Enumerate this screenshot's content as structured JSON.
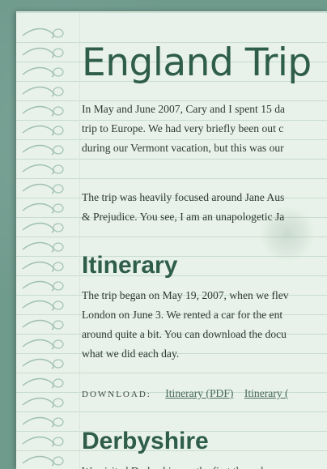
{
  "page": {
    "title": "England Trip",
    "intro": [
      "In May and June 2007, Cary and I spent 15 da",
      "trip to Europe. We had very briefly been out c",
      "during our Vermont vacation, but this was our"
    ],
    "focus": [
      "The trip was heavily focused around Jane Aus",
      "& Prejudice. You see, I am an unapologetic Ja"
    ]
  },
  "itinerary": {
    "heading": "Itinerary",
    "text": [
      "The trip began on May 19, 2007, when we flev",
      "London on June 3. We rented a car for the ent",
      "around quite a bit. You can download the docu",
      "what we did each day."
    ],
    "download_label": "DOWNLOAD:",
    "links": [
      "Itinerary (PDF)",
      "Itinerary ("
    ]
  },
  "derbyshire": {
    "heading": "Derbyshire",
    "text": [
      "We visited Derbyshire on the first three days o"
    ]
  },
  "colors": {
    "background": "#6f9b8d",
    "paper": "#e8f2ea",
    "heading": "#2f5d4c",
    "rule": "#c8dccf"
  }
}
